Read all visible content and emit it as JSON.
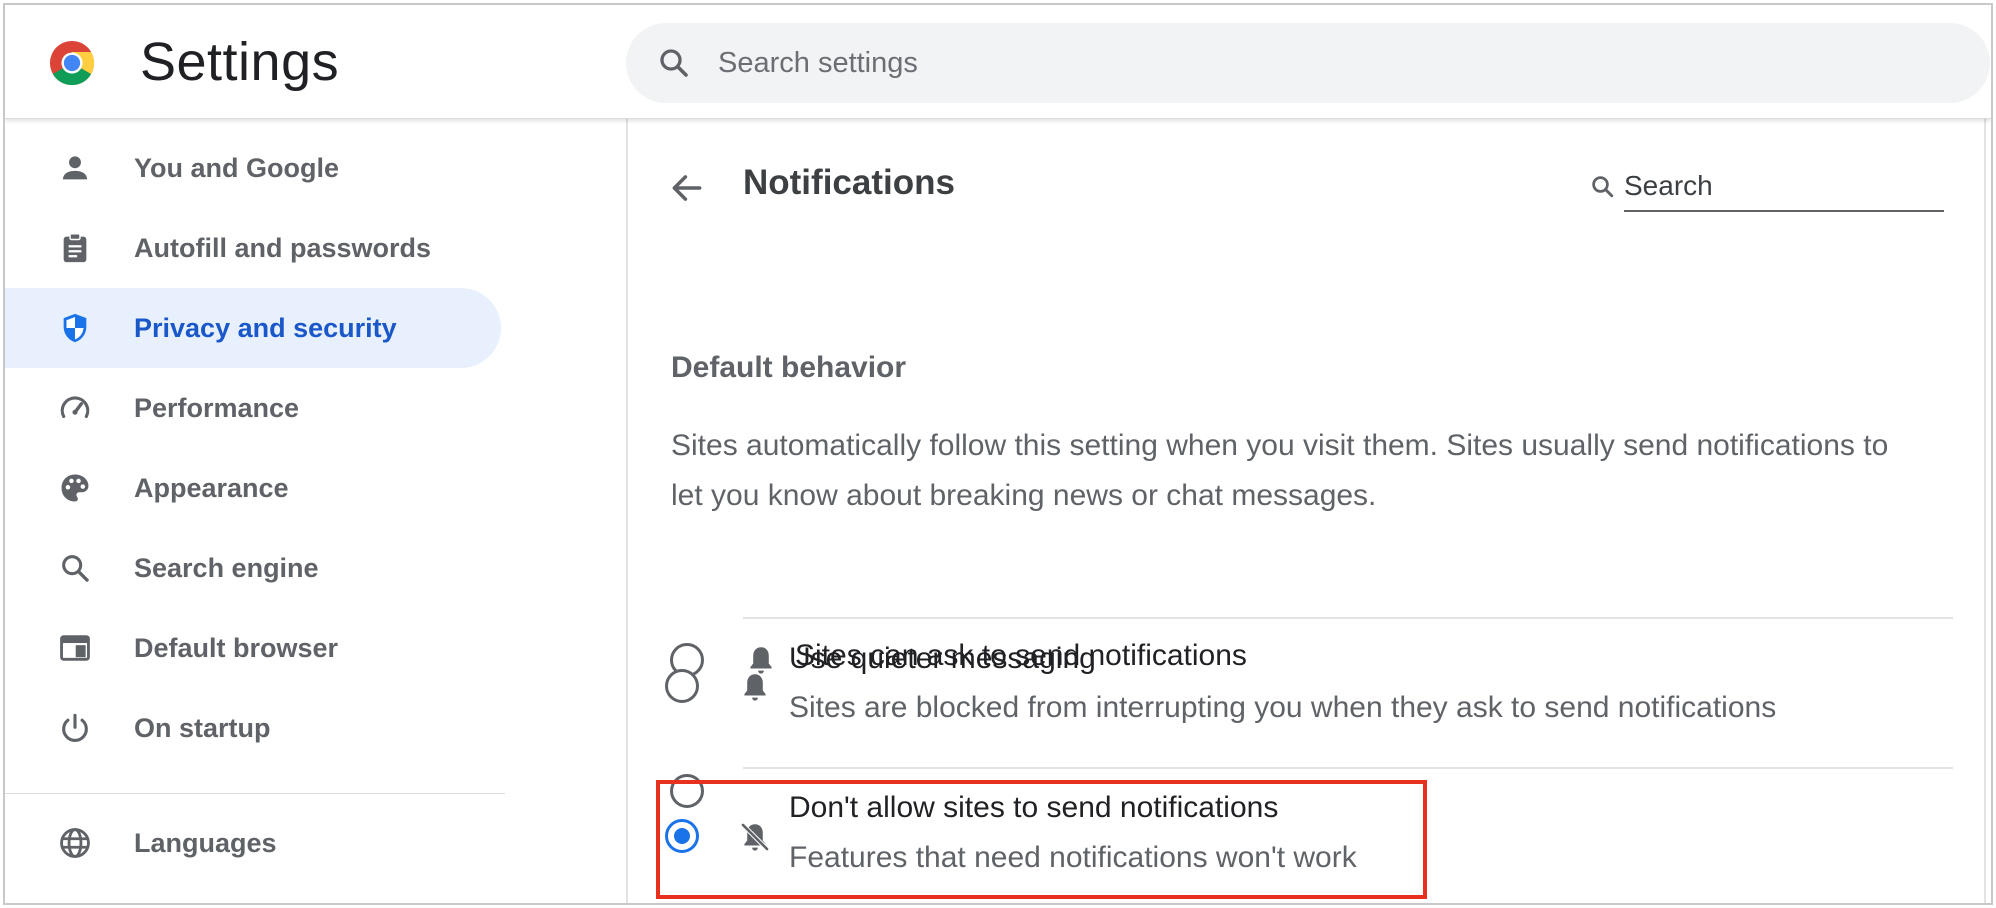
{
  "header": {
    "app_title": "Settings",
    "search_placeholder": "Search settings",
    "logo_icon": "chrome-logo-icon",
    "search_icon": "search-icon"
  },
  "sidebar": {
    "items": [
      {
        "label": "You and Google",
        "icon": "person-icon",
        "active": false
      },
      {
        "label": "Autofill and passwords",
        "icon": "clipboard-icon",
        "active": false
      },
      {
        "label": "Privacy and security",
        "icon": "shield-icon",
        "active": true
      },
      {
        "label": "Performance",
        "icon": "speedometer-icon",
        "active": false
      },
      {
        "label": "Appearance",
        "icon": "palette-icon",
        "active": false
      },
      {
        "label": "Search engine",
        "icon": "search-icon",
        "active": false
      },
      {
        "label": "Default browser",
        "icon": "browser-window-icon",
        "active": false
      },
      {
        "label": "On startup",
        "icon": "power-icon",
        "active": false
      },
      {
        "label": "Languages",
        "icon": "globe-icon",
        "active": false
      }
    ]
  },
  "main": {
    "page_title": "Notifications",
    "back_icon": "arrow-back-icon",
    "search_placeholder": "Search",
    "section_title": "Default behavior",
    "section_description": "Sites automatically follow this setting when you visit them. Sites usually send notifications to let you know about breaking news or chat messages.",
    "options": [
      {
        "title": "Sites can ask to send notifications",
        "subtitle": "",
        "icon": "bell-icon",
        "selected": false
      },
      {
        "title": "Use quieter messaging",
        "subtitle": "Sites are blocked from interrupting you when they ask to send notifications",
        "icon": "bell-icon",
        "selected": false
      },
      {
        "title": "Don't allow sites to send notifications",
        "subtitle": "Features that need notifications won't work",
        "icon": "bell-off-icon",
        "selected": true
      }
    ]
  },
  "colors": {
    "accent": "#1a73e8",
    "active_nav_bg": "#e8f0fe",
    "active_nav_text": "#1a57c8",
    "highlight_box": "#e8301f"
  }
}
